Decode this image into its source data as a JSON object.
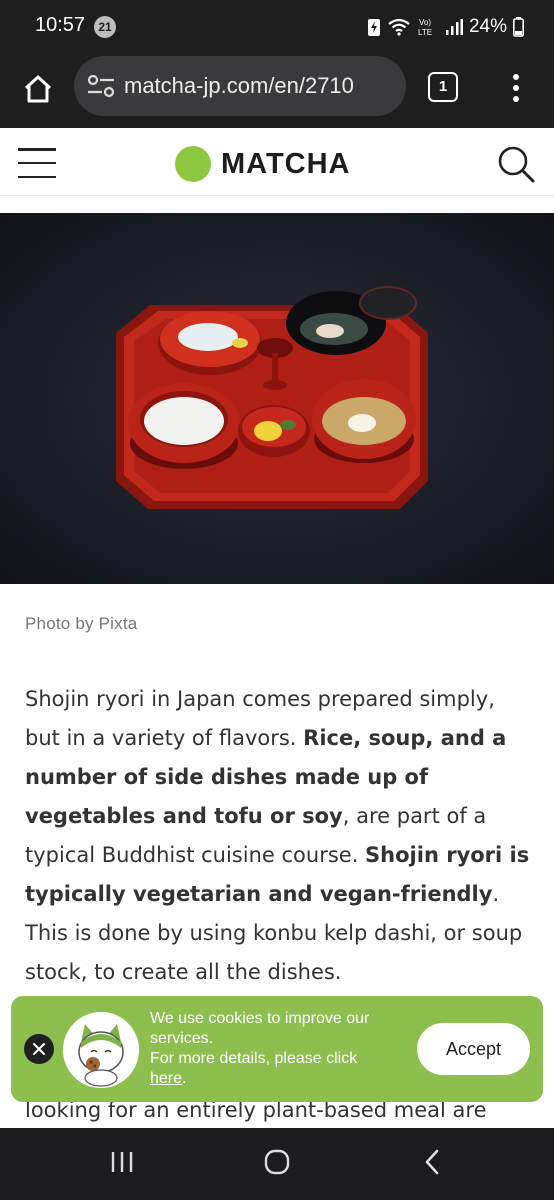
{
  "status_bar": {
    "time": "10:57",
    "notification_count": "21",
    "battery_percent": "24%"
  },
  "browser": {
    "url": "matcha-jp.com/en/2710",
    "tab_count": "1"
  },
  "site": {
    "logo_text": "MATCHA",
    "accent_color": "#8dc63f"
  },
  "article": {
    "photo_caption": "Photo by Pixta",
    "paragraph_parts": [
      {
        "text": "Shojin ryori in Japan comes prepared simply, but in a variety of flavors. ",
        "bold": false
      },
      {
        "text": "Rice, soup, and a number of side dishes made up of vegetables and tofu or soy",
        "bold": true
      },
      {
        "text": ", are part of a typical Buddhist cuisine course. ",
        "bold": false
      },
      {
        "text": "Shojin ryori is typically vegetarian and vegan-friendly",
        "bold": true
      },
      {
        "text": ". This is done by using konbu kelp dashi, or soup stock, to create all the dishes.",
        "bold": false
      }
    ],
    "next_line_text": "looking for an entirely plant-based meal are"
  },
  "cookie_banner": {
    "message_line1": "We use cookies to improve our services.",
    "message_line2": "For more details, please click",
    "link_text": "here",
    "link_suffix": ".",
    "accept_label": "Accept",
    "background_color": "#8dbf4f"
  },
  "icons": {
    "home": "home-icon",
    "site_settings": "tune-icon",
    "tabs": "tabs-icon",
    "overflow_menu": "more-vert-icon",
    "hamburger": "menu-icon",
    "search": "search-icon",
    "close": "close-icon",
    "nav_recents": "recents-icon",
    "nav_home": "nav-home-icon",
    "nav_back": "back-icon"
  }
}
